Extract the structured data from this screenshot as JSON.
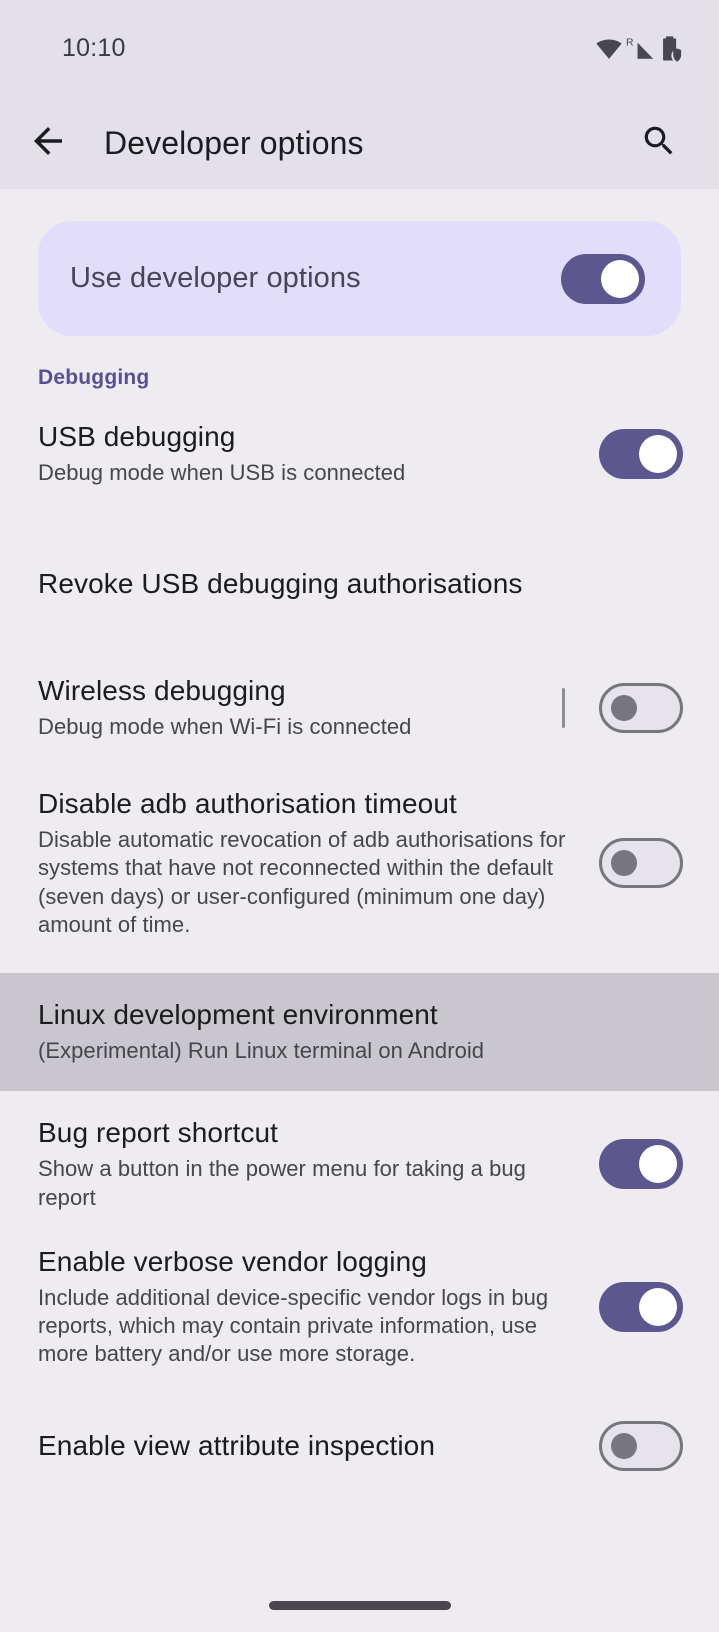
{
  "status_bar": {
    "time": "10:10",
    "icons": [
      "wifi-icon",
      "cellular-signal-roaming-icon",
      "battery-protected-icon"
    ],
    "roaming_label": "R"
  },
  "app_bar": {
    "back_icon": "arrow-back-icon",
    "title": "Developer options",
    "search_icon": "search-icon"
  },
  "master_switch": {
    "label": "Use developer options",
    "state": "on"
  },
  "sections": [
    {
      "header": "Debugging"
    }
  ],
  "preferences": [
    {
      "title": "USB debugging",
      "summary": "Debug mode when USB is connected",
      "state": "on"
    },
    {
      "title": "Revoke USB debugging authorisations",
      "summary": "",
      "state": "none"
    },
    {
      "title": "Wireless debugging",
      "summary": "Debug mode when Wi-Fi is connected",
      "state": "off",
      "has_divider": true
    },
    {
      "title": "Disable adb authorisation timeout",
      "summary": "Disable automatic revocation of adb authorisations for systems that have not reconnected within the default (seven days) or user-configured (minimum one day) amount of time.",
      "state": "off"
    },
    {
      "title": "Linux development environment",
      "summary": "(Experimental) Run Linux terminal on Android",
      "state": "none",
      "highlighted": true
    },
    {
      "title": "Bug report shortcut",
      "summary": "Show a button in the power menu for taking a bug report",
      "state": "on"
    },
    {
      "title": "Enable verbose vendor logging",
      "summary": "Include additional device-specific vendor logs in bug reports, which may contain private information, use more battery and/or use more storage.",
      "state": "on"
    },
    {
      "title": "Enable view attribute inspection",
      "summary": "",
      "state": "off"
    }
  ],
  "navigation": {
    "gesture_bar": "home-gesture-bar"
  },
  "colors": {
    "accent_purple": "#5c578f",
    "section_header": "#575193",
    "card_background": "#e2ddfb",
    "app_bar_background": "#e3e0e9",
    "page_background": "#eeebf1",
    "highlight_row": "#c9c6cd"
  }
}
